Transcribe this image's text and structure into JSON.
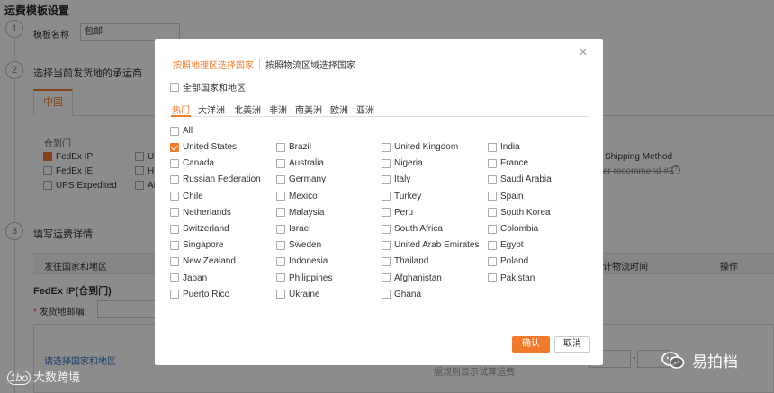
{
  "background": {
    "page_title": "运费模板设置",
    "step1": {
      "num": "1",
      "label": "模板名称",
      "value": "包邮"
    },
    "step2": {
      "num": "2",
      "label": "选择当前发货地的承运商"
    },
    "tab_china": "中国",
    "door_to_door": "仓到门",
    "carriers": [
      {
        "label": "FedEx IP",
        "checked": true
      },
      {
        "label": "FedEx IE",
        "checked": false
      },
      {
        "label": "UPS Expedited",
        "checked": false
      }
    ],
    "carriers_col2": [
      "UI",
      "HI",
      "AI"
    ],
    "shipping_method": "Shipping Method",
    "recommend": "er recommend #2",
    "help_icon": "?",
    "step3": {
      "num": "3",
      "label": "填写运费详情"
    },
    "table_headers": {
      "dest": "发往国家和地区",
      "time": "计物流时间",
      "ops": "操作"
    },
    "fedex_section": "FedEx IP(仓到门)",
    "postcode_label": "发货地邮编:",
    "select_region_link": "请选择国家和地区",
    "calc_hint": "据规则显示试算运费",
    "range_sep": "-"
  },
  "modal": {
    "mode_tabs": {
      "geo": "按照地理区选择国家",
      "logistics": "按照物流区域选择国家"
    },
    "all_regions": "全部国家和地区",
    "continents": [
      "热门",
      "大洋洲",
      "北美洲",
      "非洲",
      "南美洲",
      "欧洲",
      "亚洲"
    ],
    "active_continent": "热门",
    "all_label": "All",
    "countries": [
      [
        {
          "name": "United States",
          "checked": true
        },
        {
          "name": "Canada"
        },
        {
          "name": "Russian Federation"
        },
        {
          "name": "Chile"
        },
        {
          "name": "Netherlands"
        },
        {
          "name": "Switzerland"
        },
        {
          "name": "Singapore"
        },
        {
          "name": "New Zealand"
        },
        {
          "name": "Japan"
        },
        {
          "name": "Puerto Rico"
        }
      ],
      [
        {
          "name": "Brazil"
        },
        {
          "name": "Australia"
        },
        {
          "name": "Germany"
        },
        {
          "name": "Mexico"
        },
        {
          "name": "Malaysia"
        },
        {
          "name": "Israel"
        },
        {
          "name": "Sweden"
        },
        {
          "name": "Indonesia"
        },
        {
          "name": "Philippines"
        },
        {
          "name": "Ukraine"
        }
      ],
      [
        {
          "name": "United Kingdom"
        },
        {
          "name": "Nigeria"
        },
        {
          "name": "Italy"
        },
        {
          "name": "Turkey"
        },
        {
          "name": "Peru"
        },
        {
          "name": "South Africa"
        },
        {
          "name": "United Arab Emirates"
        },
        {
          "name": "Thailand"
        },
        {
          "name": "Afghanistan"
        },
        {
          "name": "Ghana"
        }
      ],
      [
        {
          "name": "India"
        },
        {
          "name": "France"
        },
        {
          "name": "Saudi Arabia"
        },
        {
          "name": "Spain"
        },
        {
          "name": "South Korea"
        },
        {
          "name": "Colombia"
        },
        {
          "name": "Egypt"
        },
        {
          "name": "Poland"
        },
        {
          "name": "Pakistan"
        }
      ]
    ],
    "ok": "确认",
    "cancel": "取消",
    "close_icon": "×"
  },
  "watermarks": {
    "left": "大数跨境",
    "left_logo": "1bo",
    "right": "易拍档"
  },
  "colors": {
    "accent": "#f07b2c",
    "link": "#2b72c4"
  }
}
